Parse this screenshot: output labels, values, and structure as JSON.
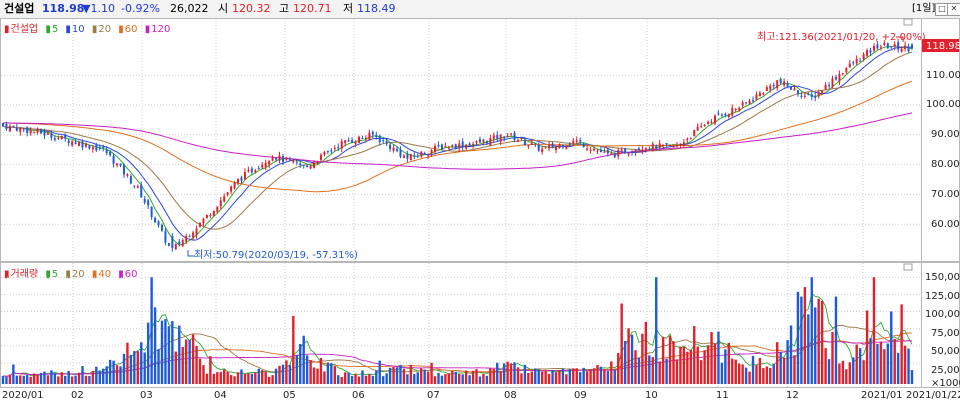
{
  "header": {
    "name": "건설업",
    "price": "118.98",
    "change": "▼1.10",
    "change_pct": "-0.92%",
    "volume": "26,022",
    "open_label": "시",
    "open": "120.32",
    "high_label": "고",
    "high": "120.71",
    "low_label": "저",
    "low": "118.49",
    "period_button": "[1일]",
    "icon_names": [
      "maximize-icon",
      "close-icon"
    ]
  },
  "price_panel": {
    "legend": {
      "main": "건설업",
      "ma": [
        "5",
        "10",
        "20",
        "60",
        "120"
      ]
    },
    "last_price_tag": "118.98",
    "max_annotation": "최고:121.36(2021/01/20, +2.00%)",
    "min_annotation": "최저:50.79(2020/03/19, -57.31%)",
    "y_ticks": [
      "110.00",
      "100.00",
      "90.00",
      "80.00",
      "70.00",
      "60.00"
    ]
  },
  "volume_panel": {
    "legend": {
      "main": "거래량",
      "ma": [
        "5",
        "20",
        "40",
        "60"
      ]
    },
    "y_ticks": [
      "150,000",
      "125,000",
      "100,000",
      "75,000",
      "50,000",
      "25,000"
    ],
    "unit": "×1000"
  },
  "x_axis": {
    "labels": [
      "2020/01",
      "02",
      "03",
      "04",
      "05",
      "06",
      "07",
      "08",
      "09",
      "10",
      "11",
      "12",
      "2021/01"
    ],
    "last_date": "2021/01/22"
  },
  "colors": {
    "up": "#e0202a",
    "down": "#1e5bd6",
    "ma5": "#2ea82e",
    "ma10": "#2b45d8",
    "ma20": "#9b7a45",
    "ma60": "#e0701e",
    "ma120": "#c81ec8"
  },
  "chart_data": {
    "type": "candlestick",
    "price_anchors": {
      "dates": [
        "2020/01/02",
        "2020/01/20",
        "2020/02/05",
        "2020/02/24",
        "2020/03/09",
        "2020/03/19",
        "2020/04/01",
        "2020/04/15",
        "2020/05/01",
        "2020/05/20",
        "2020/06/05",
        "2020/06/15",
        "2020/07/01",
        "2020/07/20",
        "2020/08/03",
        "2020/08/13",
        "2020/08/25",
        "2020/09/15",
        "2020/10/05",
        "2020/10/30",
        "2020/11/10",
        "2020/11/25",
        "2020/12/07",
        "2020/12/14",
        "2020/12/24",
        "2021/01/05",
        "2021/01/20",
        "2021/01/22"
      ],
      "close": [
        93,
        91,
        88,
        85,
        72,
        51,
        62,
        75,
        83,
        79,
        87,
        90,
        82,
        86,
        87,
        90,
        85,
        88,
        83,
        86,
        86,
        95,
        100,
        108,
        102,
        112,
        120,
        118.98
      ]
    },
    "price_high": 121.36,
    "price_low": 50.79,
    "volume_anchors_k": [
      8,
      10,
      12,
      18,
      60,
      118,
      20,
      15,
      12,
      55,
      10,
      12,
      22,
      12,
      12,
      25,
      12,
      14,
      20,
      100,
      45,
      80,
      20,
      50,
      140,
      25,
      120,
      26
    ]
  }
}
